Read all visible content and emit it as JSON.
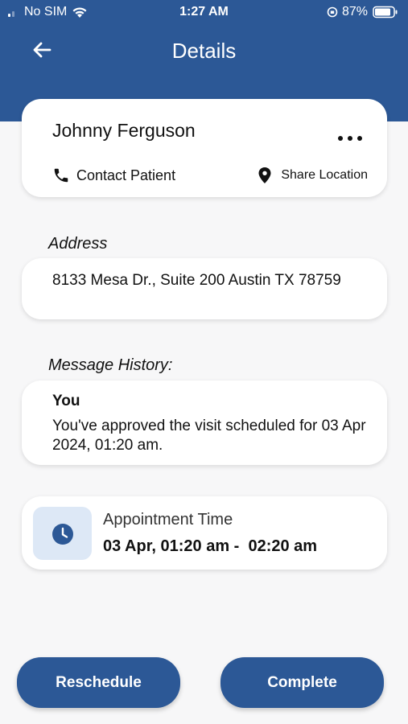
{
  "status_bar": {
    "carrier": "No SIM",
    "time": "1:27 AM",
    "battery": "87%"
  },
  "nav": {
    "title": "Details"
  },
  "patient": {
    "name": "Johnny Ferguson",
    "contact_label": "Contact Patient",
    "share_label": "Share Location"
  },
  "address": {
    "label": "Address",
    "value": "8133 Mesa Dr., Suite 200 Austin TX 78759"
  },
  "message_history": {
    "label": "Message History:",
    "author": "You",
    "text": "You've approved the visit scheduled for 03 Apr 2024, 01:20 am."
  },
  "appointment": {
    "title": "Appointment Time",
    "time": "03 Apr, 01:20 am -  02:20 am"
  },
  "actions": {
    "reschedule_label": "Reschedule",
    "complete_label": "Complete"
  },
  "colors": {
    "primary": "#2c5896",
    "clock_bg": "#dde8f6",
    "background": "#f7f7f8"
  }
}
